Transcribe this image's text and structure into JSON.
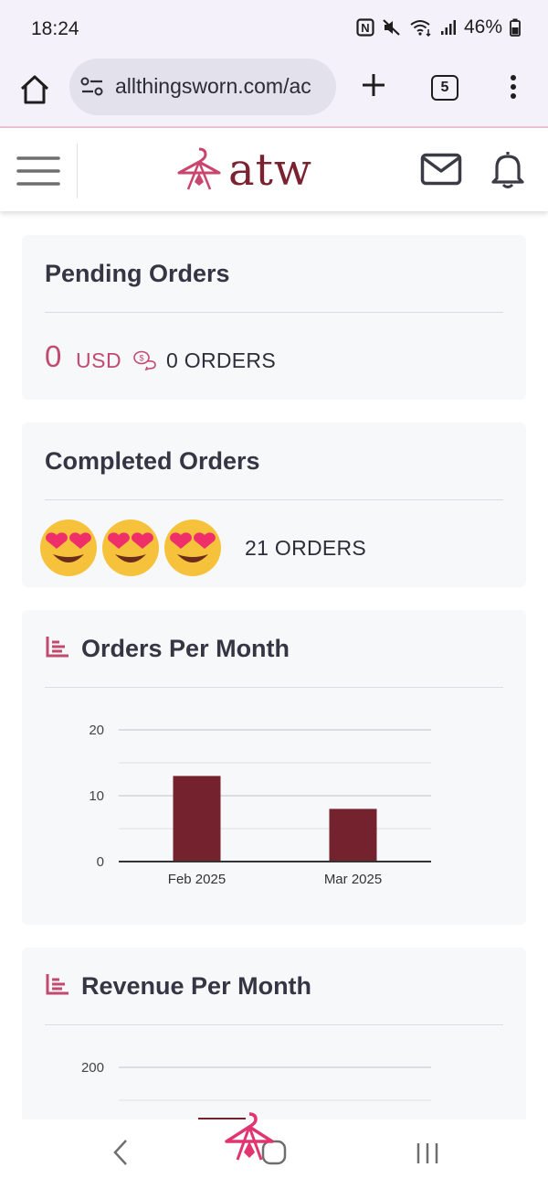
{
  "status_bar": {
    "time": "18:24",
    "battery": "46%",
    "icons": [
      "nfc-icon",
      "mute-icon",
      "wifi-icon",
      "signal-icon",
      "battery-icon"
    ]
  },
  "browser": {
    "url": "allthingsworn.com/ac",
    "tab_count": "5"
  },
  "header": {
    "logo_text": "atw"
  },
  "pending": {
    "title": "Pending Orders",
    "amount": "0",
    "currency": "USD",
    "count_label": "0 ORDERS"
  },
  "completed": {
    "title": "Completed Orders",
    "emojis": [
      "heart-eyes-emoji",
      "heart-eyes-emoji",
      "heart-eyes-emoji"
    ],
    "count_label": "21 ORDERS"
  },
  "orders_chart": {
    "title": "Orders Per Month"
  },
  "revenue_chart": {
    "title": "Revenue Per Month"
  },
  "chart_data": [
    {
      "type": "bar",
      "title": "Orders Per Month",
      "categories": [
        "Feb 2025",
        "Mar 2025"
      ],
      "values": [
        13,
        8
      ],
      "ylim": [
        0,
        20
      ],
      "yticks": [
        0,
        10,
        20
      ],
      "xlabel": "",
      "ylabel": "",
      "grid": true,
      "bar_color": "#75222f"
    },
    {
      "type": "bar",
      "title": "Revenue Per Month",
      "categories": [],
      "values": [],
      "yticks": [
        200
      ],
      "xlabel": "",
      "ylabel": "",
      "grid": true,
      "bar_color": "#75222f"
    }
  ],
  "colors": {
    "brand": "#7a2230",
    "accent_pink": "#c34a6f",
    "card_bg": "#f7f8fa",
    "bar": "#75222f"
  }
}
